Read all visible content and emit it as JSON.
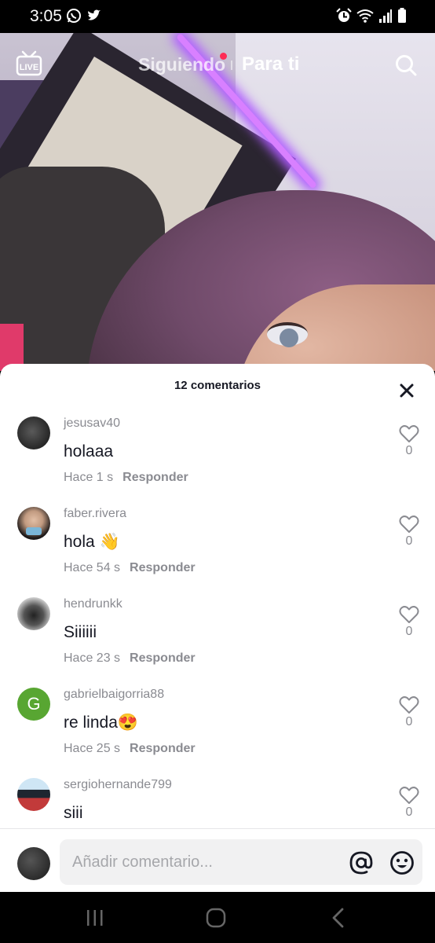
{
  "status_bar": {
    "time": "3:05",
    "left_icons": [
      "whatsapp-icon",
      "twitter-icon"
    ],
    "right_icons": [
      "alarm-icon",
      "wifi-icon",
      "signal-icon",
      "battery-icon"
    ]
  },
  "top_nav": {
    "live_label": "LIVE",
    "tabs": [
      {
        "label": "Siguiendo",
        "active": false,
        "has_notification_dot": true
      },
      {
        "label": "Para ti",
        "active": true
      }
    ]
  },
  "comments_sheet": {
    "title": "12 comentarios",
    "comments": [
      {
        "username": "jesusav40",
        "text": "holaaa",
        "time": "Hace 1 s",
        "reply_label": "Responder",
        "likes": "0"
      },
      {
        "username": "faber.rivera",
        "text": "hola 👋",
        "time": "Hace 54 s",
        "reply_label": "Responder",
        "likes": "0"
      },
      {
        "username": "hendrunkk",
        "text": "Siiiiii",
        "time": "Hace 23 s",
        "reply_label": "Responder",
        "likes": "0"
      },
      {
        "username": "gabrielbaigorria88",
        "avatar_letter": "G",
        "text": "re linda😍",
        "time": "Hace 25 s",
        "reply_label": "Responder",
        "likes": "0"
      },
      {
        "username": "sergiohernande799",
        "text": "siii",
        "time": "",
        "reply_label": "",
        "likes": "0"
      }
    ]
  },
  "comment_input": {
    "placeholder": "Añadir comentario..."
  },
  "colors": {
    "accent": "#fe2c55",
    "text_primary": "#161823",
    "text_secondary": "#8a8b91"
  }
}
